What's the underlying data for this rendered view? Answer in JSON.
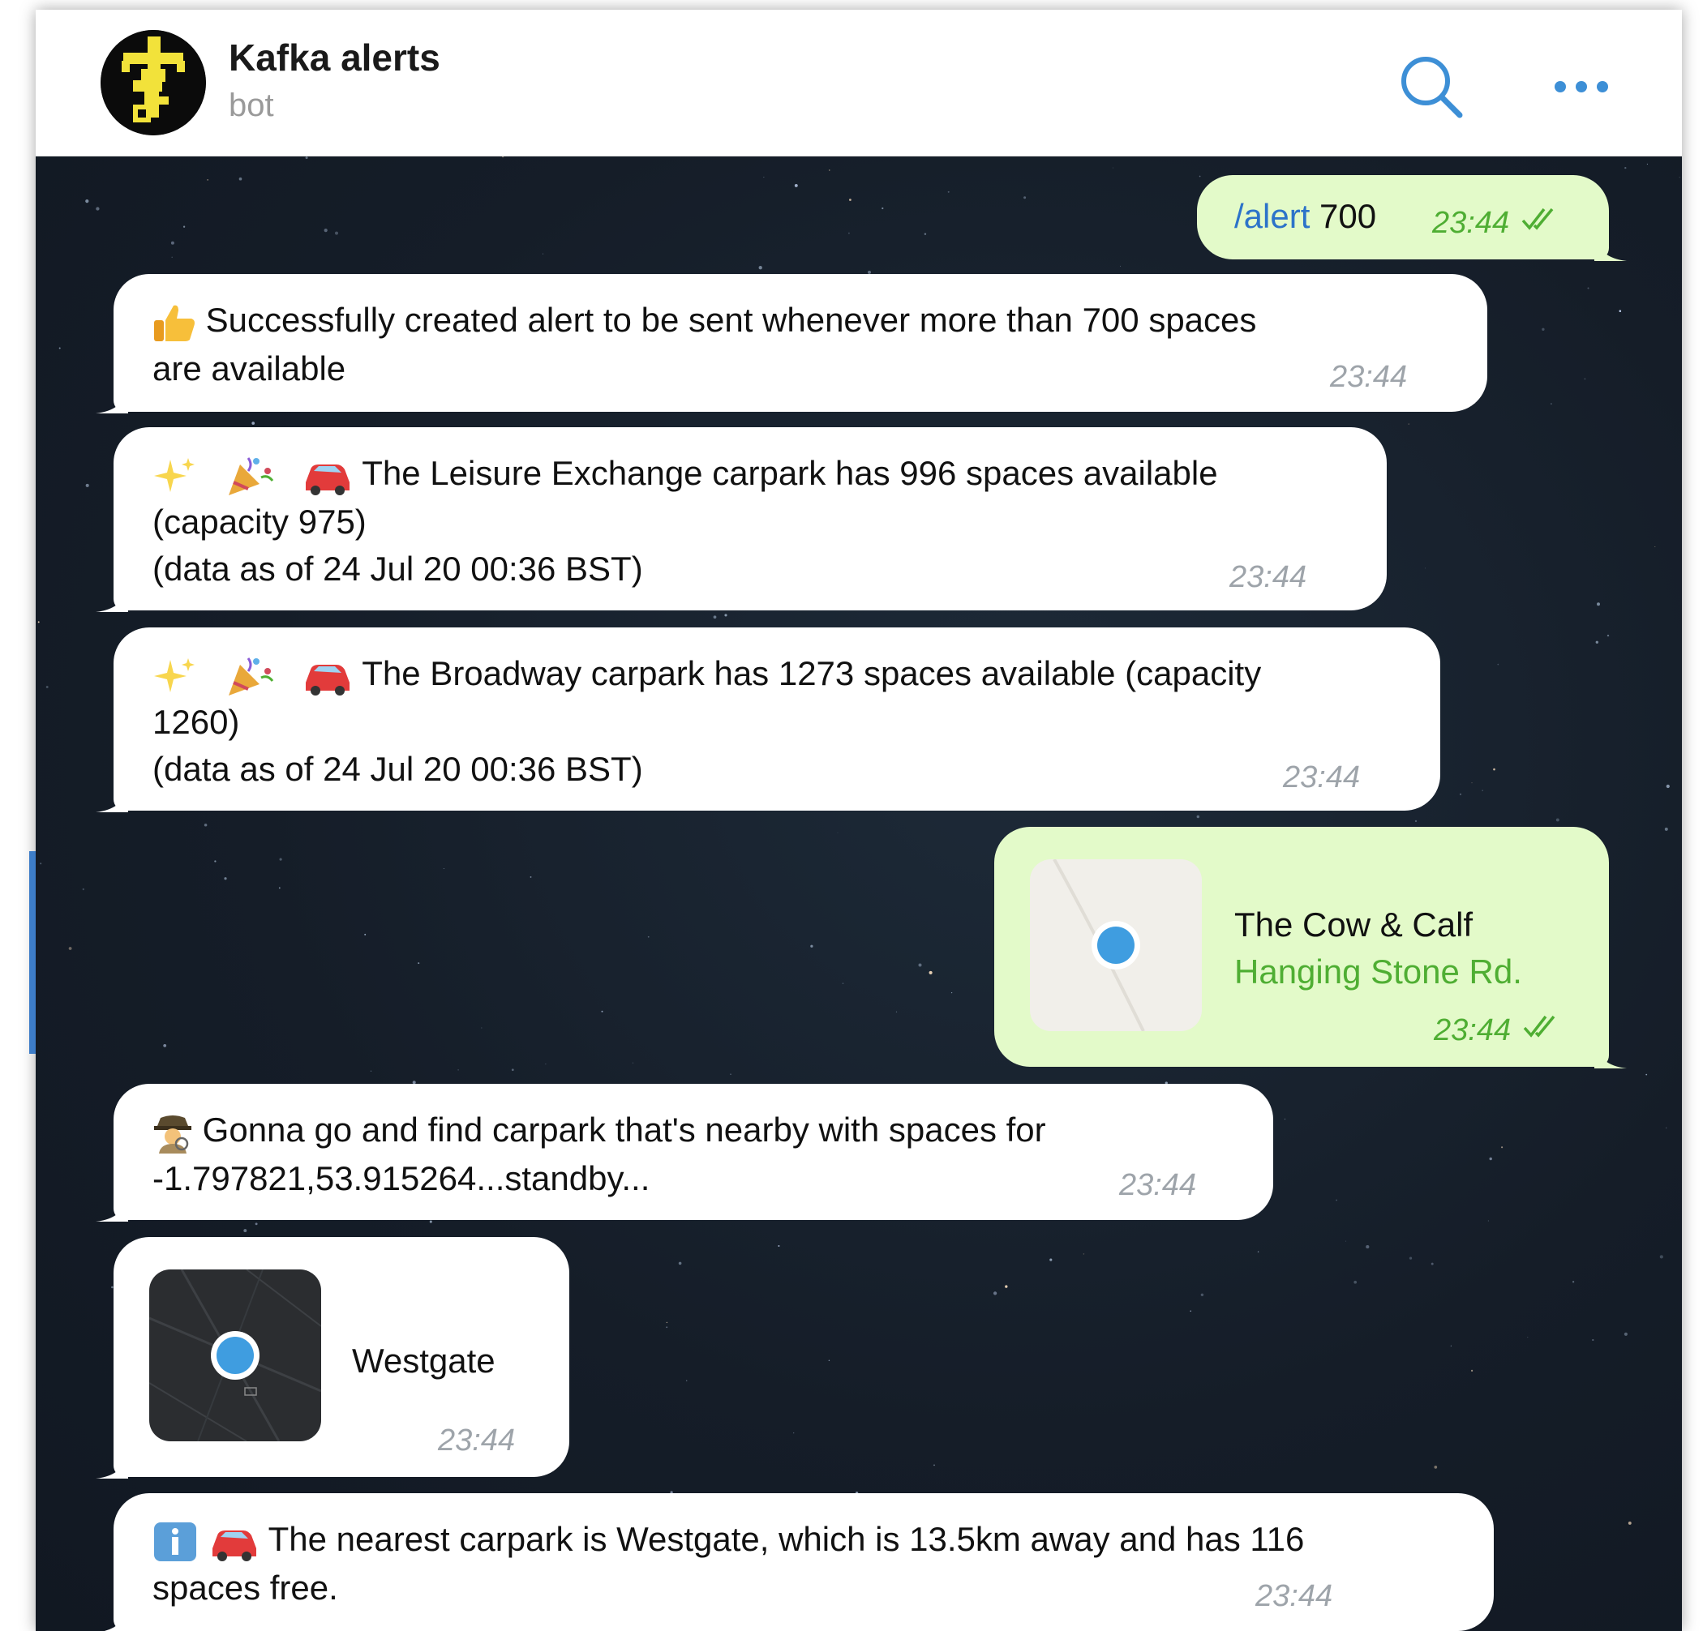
{
  "header": {
    "title": "Kafka alerts",
    "subtitle": "bot",
    "search_icon": "search-icon",
    "more_icon": "more-horizontal-icon"
  },
  "messages": [
    {
      "direction": "outgoing",
      "command": "/alert",
      "text": "700",
      "time": "23:44",
      "status": "read"
    },
    {
      "direction": "incoming",
      "emojis": [
        "thumbs-up"
      ],
      "line1": "Successfully created alert to be sent whenever more than 700 spaces",
      "line2": "are available",
      "time": "23:44"
    },
    {
      "direction": "incoming",
      "emojis": [
        "sparkles",
        "party-popper",
        "red-car"
      ],
      "line1": "The Leisure Exchange carpark has 996 spaces available",
      "line2": "(capacity 975)",
      "line3": "(data as of 24 Jul 20 00:36 BST)",
      "time": "23:44"
    },
    {
      "direction": "incoming",
      "emojis": [
        "sparkles",
        "party-popper",
        "red-car"
      ],
      "line1": "The Broadway carpark has 1273 spaces available (capacity",
      "line2": "1260)",
      "line3": "(data as of 24 Jul 20 00:36 BST)",
      "time": "23:44"
    },
    {
      "direction": "outgoing",
      "type": "location",
      "title": "The Cow & Calf",
      "address": "Hanging Stone Rd.",
      "time": "23:44",
      "status": "read"
    },
    {
      "direction": "incoming",
      "emojis": [
        "detective"
      ],
      "line1": "Gonna go and find carpark that's nearby with spaces for",
      "line2": "-1.797821,53.915264...standby...",
      "time": "23:44"
    },
    {
      "direction": "incoming",
      "type": "location",
      "title": "Westgate",
      "time": "23:44"
    },
    {
      "direction": "incoming",
      "emojis": [
        "information",
        "red-car"
      ],
      "line1": "The nearest carpark is Westgate, which is 13.5km away and has 116",
      "line2": "spaces free.",
      "time": "23:44"
    }
  ],
  "colors": {
    "outgoing_bubble": "#e3fac9",
    "incoming_bubble": "#ffffff",
    "accent_blue": "#2c73c9",
    "outgoing_time": "#4fae33",
    "chat_background": "#151d28"
  }
}
